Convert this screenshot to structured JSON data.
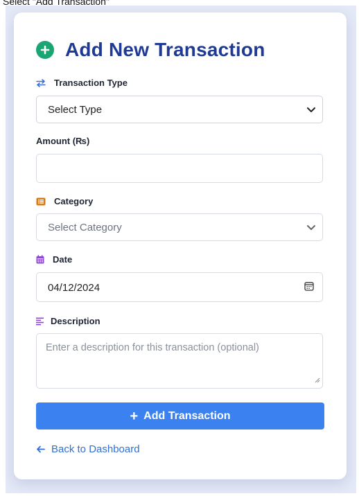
{
  "window": {
    "caption": "Select \"Add Transaction\""
  },
  "header": {
    "title": "Add New Transaction",
    "icon": "plus-circle-icon",
    "icon_color": "#1aa672",
    "title_color": "#1f3a93"
  },
  "form": {
    "transaction_type": {
      "label": "Transaction Type",
      "icon": "swap-arrows-icon",
      "value": "Select Type"
    },
    "amount": {
      "label": "Amount (₨)",
      "value": ""
    },
    "category": {
      "label": "Category",
      "icon": "list-icon",
      "value": "Select Category"
    },
    "date": {
      "label": "Date",
      "icon": "calendar-icon",
      "value": "04/12/2024"
    },
    "description": {
      "label": "Description",
      "icon": "align-left-icon",
      "placeholder": "Enter a description for this transaction (optional)"
    }
  },
  "actions": {
    "submit_label": "Add Transaction",
    "submit_color": "#3b82f0",
    "back_label": "Back to Dashboard",
    "back_color": "#2f6fd6"
  }
}
